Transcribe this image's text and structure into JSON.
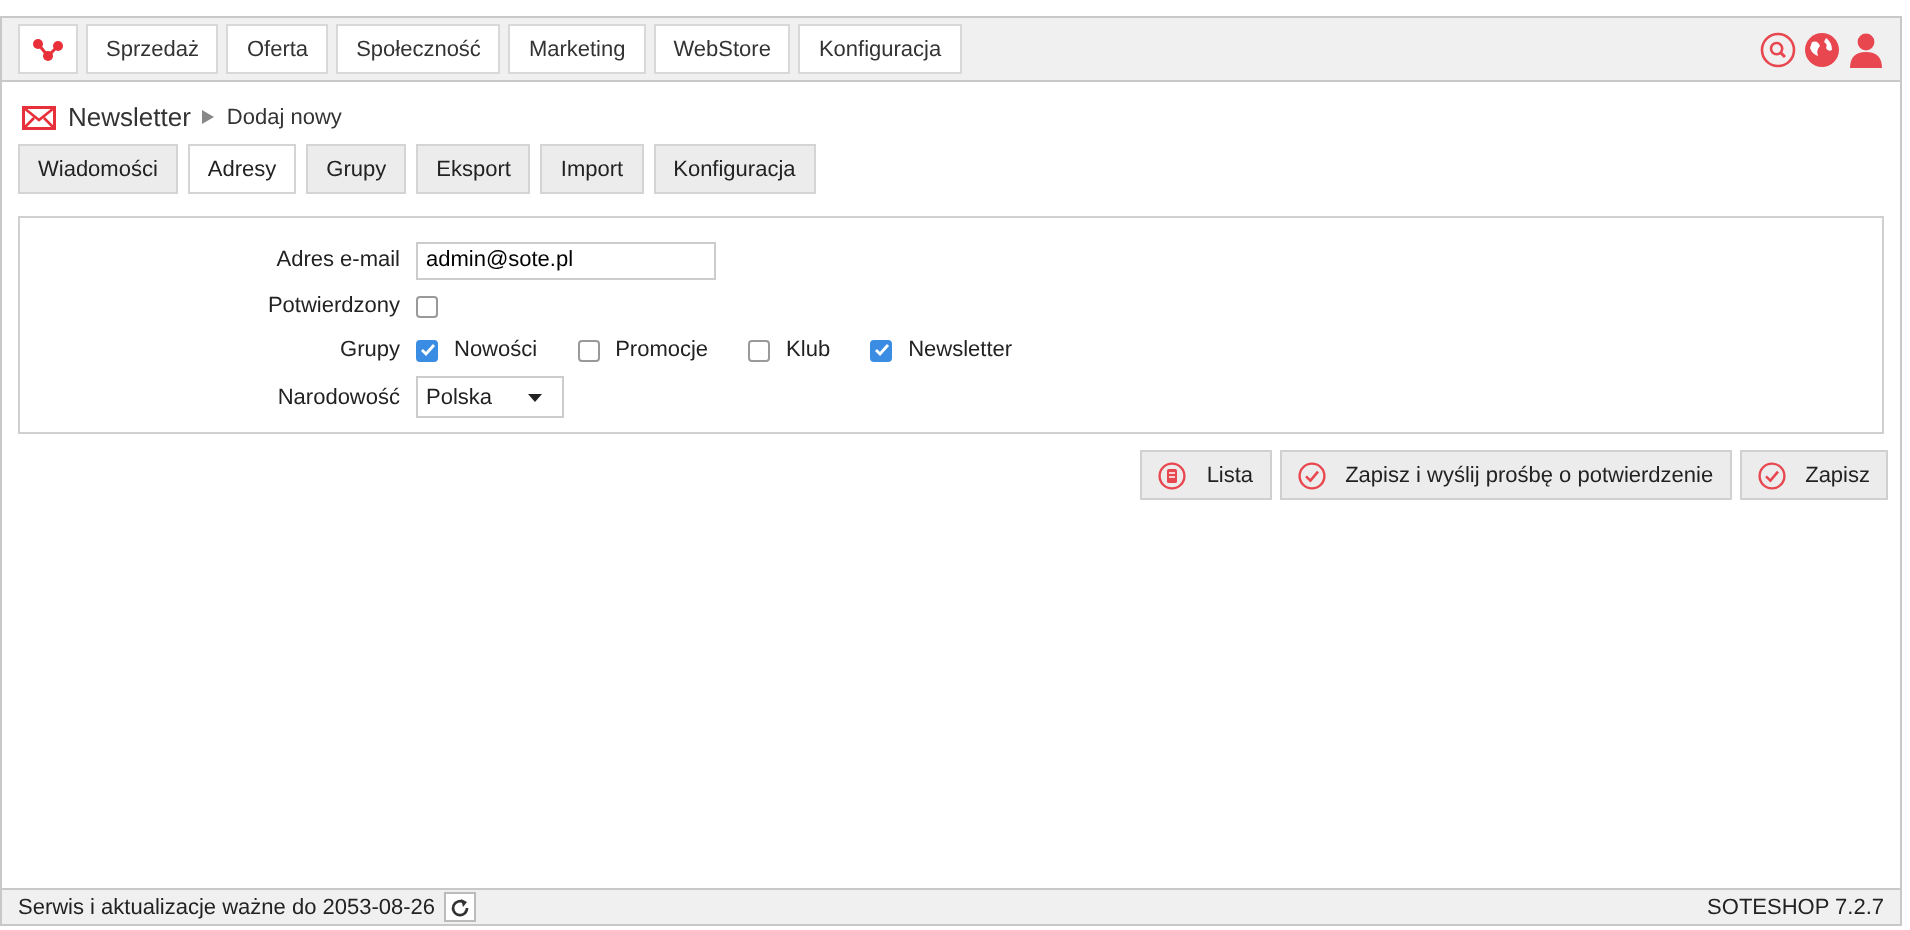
{
  "top_menu": [
    {
      "label": "Sprzedaż"
    },
    {
      "label": "Oferta"
    },
    {
      "label": "Społeczność"
    },
    {
      "label": "Marketing"
    },
    {
      "label": "WebStore"
    },
    {
      "label": "Konfiguracja"
    }
  ],
  "breadcrumb": {
    "title": "Newsletter",
    "current": "Dodaj nowy"
  },
  "tabs": [
    {
      "label": "Wiadomości",
      "selected": false
    },
    {
      "label": "Adresy",
      "selected": true
    },
    {
      "label": "Grupy",
      "selected": false
    },
    {
      "label": "Eksport",
      "selected": false
    },
    {
      "label": "Import",
      "selected": false
    },
    {
      "label": "Konfiguracja",
      "selected": false
    }
  ],
  "form": {
    "email": {
      "label": "Adres e-mail",
      "value": "admin@sote.pl"
    },
    "confirmed": {
      "label": "Potwierdzony",
      "checked": false
    },
    "groups": {
      "label": "Grupy",
      "items": [
        {
          "label": "Nowości",
          "checked": true
        },
        {
          "label": "Promocje",
          "checked": false
        },
        {
          "label": "Klub",
          "checked": false
        },
        {
          "label": "Newsletter",
          "checked": true
        }
      ]
    },
    "nationality": {
      "label": "Narodowość",
      "value": "Polska"
    }
  },
  "buttons": [
    {
      "label": "Lista",
      "kind": "list"
    },
    {
      "label": "Zapisz i wyślij prośbę o potwierdzenie",
      "kind": "save"
    },
    {
      "label": "Zapisz",
      "kind": "save"
    }
  ],
  "status_bar": {
    "license": "Serwis i aktualizacje ważne do 2053-08-26",
    "version": "SOTESHOP 7.2.7"
  }
}
